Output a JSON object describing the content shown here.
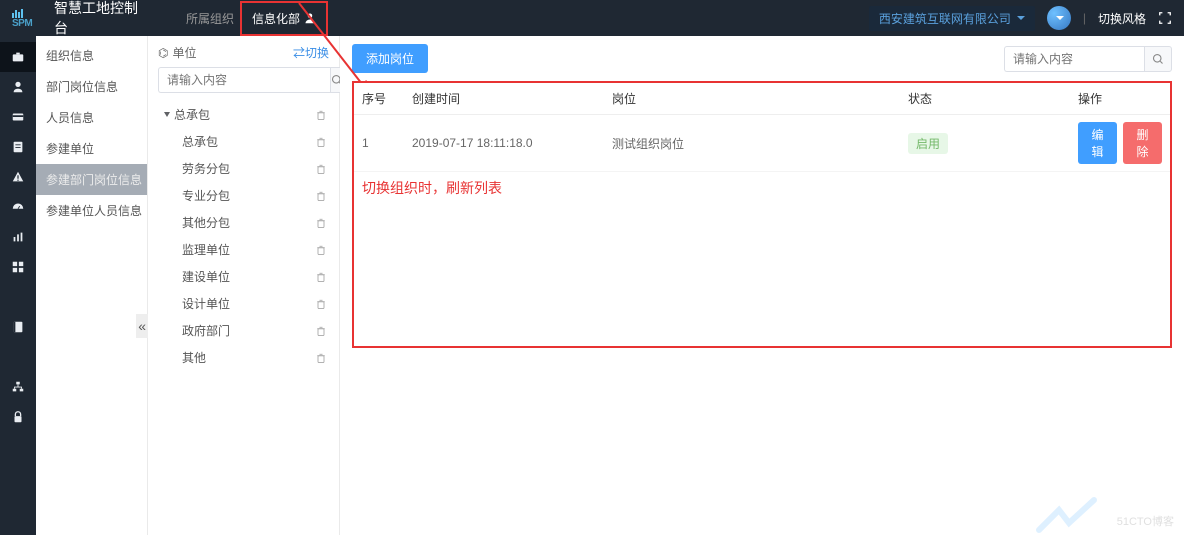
{
  "header": {
    "logo_text": "SPM",
    "app_title": "智慧工地控制台",
    "crumb1": "所属组织",
    "crumb2": "信息化部",
    "org_name": "西安建筑互联网有限公司",
    "switch_theme": "切换风格"
  },
  "icon_bar": [
    {
      "name": "briefcase-icon"
    },
    {
      "name": "user-icon"
    },
    {
      "name": "card-icon"
    },
    {
      "name": "doc-icon"
    },
    {
      "name": "warning-icon"
    },
    {
      "name": "dashboard-icon"
    },
    {
      "name": "chart-icon"
    },
    {
      "name": "grid-icon"
    },
    {
      "name": "book-icon"
    },
    {
      "name": "tree-icon"
    },
    {
      "name": "lock-icon"
    }
  ],
  "nav": {
    "items": [
      {
        "label": "组织信息"
      },
      {
        "label": "部门岗位信息"
      },
      {
        "label": "人员信息"
      },
      {
        "label": "参建单位"
      },
      {
        "label": "参建部门岗位信息",
        "selected": true
      },
      {
        "label": "参建单位人员信息"
      }
    ]
  },
  "tree": {
    "title_icon": "⌬",
    "title": "单位",
    "switch": "⇄切换",
    "search_placeholder": "请输入内容",
    "root": "总承包",
    "children": [
      "总承包",
      "劳务分包",
      "专业分包",
      "其他分包",
      "监理单位",
      "建设单位",
      "设计单位",
      "政府部门",
      "其他"
    ]
  },
  "main": {
    "add_button": "添加岗位",
    "search_placeholder": "请输入内容",
    "columns": {
      "index": "序号",
      "create_time": "创建时间",
      "post": "岗位",
      "status": "状态",
      "operation": "操作"
    },
    "rows": [
      {
        "index": "1",
        "create_time": "2019-07-17 18:11:18.0",
        "post": "测试组织岗位",
        "status": "启用"
      }
    ],
    "edit_label": "编 辑",
    "delete_label": "删 除",
    "annotation": "切换组织时，刷新列表"
  },
  "watermark": "51CTO博客"
}
